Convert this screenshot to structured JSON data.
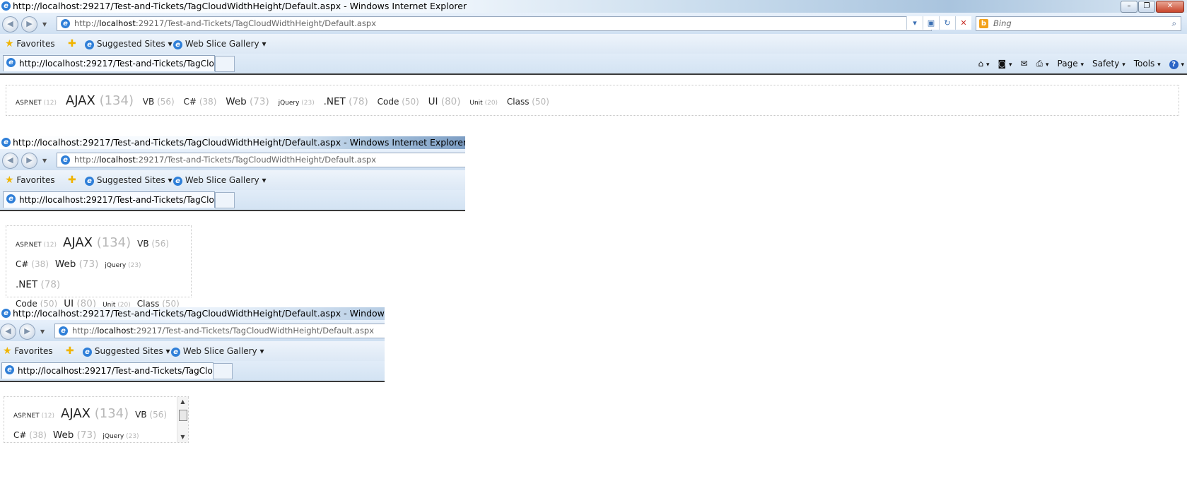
{
  "window_title": "http://localhost:29217/Test-and-Tickets/TagCloudWidthHeight/Default.aspx - Windows Internet Explorer",
  "window_title_cut": "http://localhost:29217/Test-and-Tickets/TagCloudWidthHeight/Default.aspx - Windows Internet Ex",
  "address": {
    "prefix": "http://",
    "host": "localhost",
    "rest": ":29217/Test-and-Tickets/TagCloudWidthHeight/Default.aspx"
  },
  "search_placeholder": "Bing",
  "favorites": {
    "label": "Favorites",
    "suggested": "Suggested Sites",
    "webslice": "Web Slice Gallery"
  },
  "tab_title": "http://localhost:29217/Test-and-Tickets/TagClou...",
  "commands": {
    "page": "Page",
    "safety": "Safety",
    "tools": "Tools"
  },
  "tags": [
    {
      "name": "ASP.NET",
      "count": "(12)"
    },
    {
      "name": "AJAX",
      "count": "(134)"
    },
    {
      "name": "VB",
      "count": "(56)"
    },
    {
      "name": "C#",
      "count": "(38)"
    },
    {
      "name": "Web",
      "count": "(73)"
    },
    {
      "name": "jQuery",
      "count": "(23)"
    },
    {
      "name": ".NET",
      "count": "(78)"
    },
    {
      "name": "Code",
      "count": "(50)"
    },
    {
      "name": "UI",
      "count": "(80)"
    },
    {
      "name": "Unit",
      "count": "(20)"
    },
    {
      "name": "Class",
      "count": "(50)"
    }
  ],
  "icons": {
    "star": "favorites-star-icon",
    "ie": "ie-page-icon",
    "home": "home-icon",
    "rss": "rss-icon",
    "print": "print-icon",
    "help": "help-icon"
  },
  "colors": {
    "tag_count": "#b7b7b7",
    "tab_underline": "#3a3a3a"
  }
}
